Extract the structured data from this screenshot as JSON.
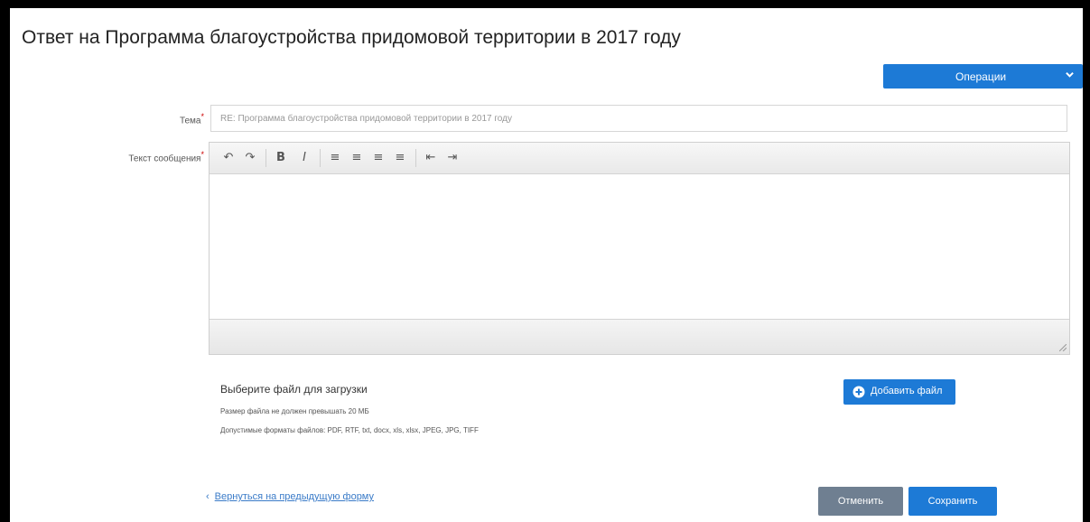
{
  "page": {
    "title": "Ответ на Программа благоустройства придомовой территории в 2017 году"
  },
  "operations": {
    "label": "Операции"
  },
  "form": {
    "subject_label": "Тема",
    "subject_value": "RE: Программа благоустройства придомовой территории в 2017 году",
    "message_label": "Текст сообщения",
    "required_mark": "*"
  },
  "toolbar": {
    "buttons": [
      {
        "name": "undo-icon",
        "glyph": "↶"
      },
      {
        "name": "redo-icon",
        "glyph": "↷"
      },
      {
        "name": "bold-icon",
        "glyph": "B"
      },
      {
        "name": "italic-icon",
        "glyph": "I"
      },
      {
        "name": "align-left-icon",
        "glyph": "≡"
      },
      {
        "name": "align-center-icon",
        "glyph": "≡"
      },
      {
        "name": "align-right-icon",
        "glyph": "≡"
      },
      {
        "name": "align-justify-icon",
        "glyph": "≡"
      },
      {
        "name": "outdent-icon",
        "glyph": "⇤"
      },
      {
        "name": "indent-icon",
        "glyph": "⇥"
      }
    ]
  },
  "upload": {
    "title": "Выберите файл для загрузки",
    "size_hint": "Размер файла не должен превышать 20 МБ",
    "formats_hint": "Допустимые форматы файлов: PDF, RTF, txt, docx, xls, xlsx, JPEG, JPG, TIFF",
    "add_button": "Добавить файл"
  },
  "footer": {
    "back_link": "Вернуться на предыдущую форму",
    "cancel": "Отменить",
    "save": "Сохранить"
  },
  "colors": {
    "primary": "#1d7ad6",
    "secondary": "#6f7f91"
  }
}
